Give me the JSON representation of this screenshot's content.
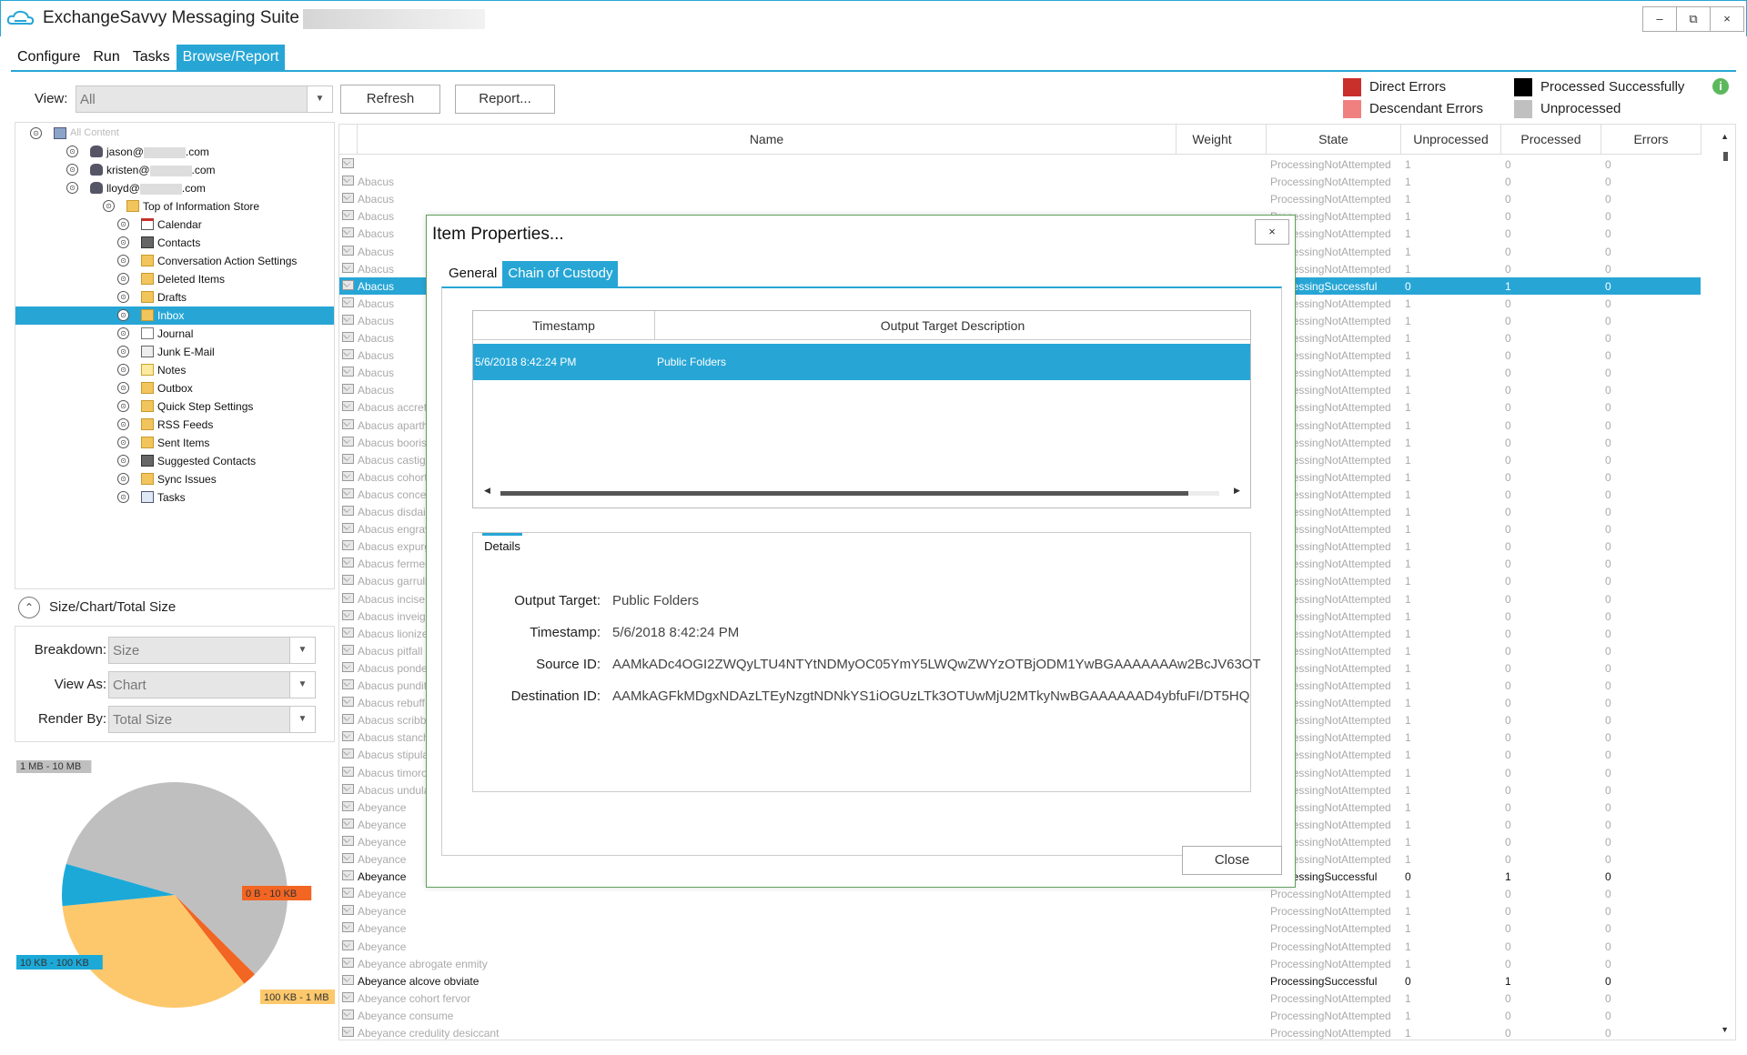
{
  "app": {
    "title": "ExchangeSavvy Messaging Suite -",
    "window_controls": {
      "minimize": "–",
      "restore": "⧉",
      "close": "×"
    }
  },
  "menu": [
    {
      "label": "Configure"
    },
    {
      "label": "Run"
    },
    {
      "label": "Tasks"
    },
    {
      "label": "Browse/Report",
      "active": true
    }
  ],
  "toolbar": {
    "view_label": "View:",
    "view_value": "All",
    "refresh_label": "Refresh",
    "report_label": "Report..."
  },
  "legend": [
    {
      "label": "Direct Errors",
      "color": "#c9302c"
    },
    {
      "label": "Descendant Errors",
      "color": "#f08080"
    },
    {
      "label": "Processed Successfully",
      "color": "#000000"
    },
    {
      "label": "Unprocessed",
      "color": "#c0c0c0"
    }
  ],
  "tree": {
    "root": "All Content",
    "users": [
      {
        "prefix": "jason@",
        "suffix": ".com"
      },
      {
        "prefix": "kristen@",
        "suffix": ".com"
      },
      {
        "prefix": "lloyd@",
        "suffix": ".com"
      }
    ],
    "store": "Top of Information Store",
    "folders": [
      {
        "label": "Calendar",
        "icon": "calendar-icon"
      },
      {
        "label": "Contacts",
        "icon": "contacts-icon"
      },
      {
        "label": "Conversation Action Settings",
        "icon": "folder-icon"
      },
      {
        "label": "Deleted Items",
        "icon": "folder-icon"
      },
      {
        "label": "Drafts",
        "icon": "folder-icon"
      },
      {
        "label": "Inbox",
        "icon": "folder-icon",
        "selected": true
      },
      {
        "label": "Journal",
        "icon": "journal-icon"
      },
      {
        "label": "Junk E-Mail",
        "icon": "junk-icon"
      },
      {
        "label": "Notes",
        "icon": "notes-icon"
      },
      {
        "label": "Outbox",
        "icon": "folder-icon"
      },
      {
        "label": "Quick Step Settings",
        "icon": "folder-icon"
      },
      {
        "label": "RSS Feeds",
        "icon": "folder-icon"
      },
      {
        "label": "Sent Items",
        "icon": "folder-icon"
      },
      {
        "label": "Suggested Contacts",
        "icon": "contacts-icon"
      },
      {
        "label": "Sync Issues",
        "icon": "folder-icon"
      },
      {
        "label": "Tasks",
        "icon": "tasks-icon"
      }
    ]
  },
  "size_panel": {
    "header": "Size/Chart/Total Size",
    "breakdown_label": "Breakdown:",
    "breakdown_value": "Size",
    "view_as_label": "View As:",
    "view_as_value": "Chart",
    "render_by_label": "Render By:",
    "render_by_value": "Total Size"
  },
  "chart_data": {
    "type": "pie",
    "slices": [
      {
        "label": "1 MB - 10 MB",
        "value": 0.58,
        "color": "#c0bfc0"
      },
      {
        "label": "0 B - 10 KB",
        "value": 0.02,
        "color": "#f26522"
      },
      {
        "label": "100 KB - 1 MB",
        "value": 0.34,
        "color": "#fdc86c"
      },
      {
        "label": "10 KB - 100 KB",
        "value": 0.06,
        "color": "#1ca9d8"
      }
    ]
  },
  "grid": {
    "columns": [
      "Name",
      "Weight",
      "State",
      "Unprocessed",
      "Processed",
      "Errors"
    ],
    "rows": [
      {
        "name": "",
        "state": "ProcessingNotAttempted",
        "u": "1",
        "p": "0",
        "e": "0"
      },
      {
        "name": "Abacus",
        "state": "ProcessingNotAttempted",
        "u": "1",
        "p": "0",
        "e": "0"
      },
      {
        "name": "Abacus",
        "state": "ProcessingNotAttempted",
        "u": "1",
        "p": "0",
        "e": "0"
      },
      {
        "name": "Abacus",
        "state": "ProcessingNotAttempted",
        "u": "1",
        "p": "0",
        "e": "0"
      },
      {
        "name": "Abacus",
        "state": "ProcessingNotAttempted",
        "u": "1",
        "p": "0",
        "e": "0"
      },
      {
        "name": "Abacus",
        "state": "ProcessingNotAttempted",
        "u": "1",
        "p": "0",
        "e": "0"
      },
      {
        "name": "Abacus",
        "state": "ProcessingNotAttempted",
        "u": "1",
        "p": "0",
        "e": "0"
      },
      {
        "name": "Abacus",
        "state": "ProcessingSuccessful",
        "u": "0",
        "p": "1",
        "e": "0",
        "selected": true
      },
      {
        "name": "Abacus",
        "state": "ProcessingNotAttempted",
        "u": "1",
        "p": "0",
        "e": "0"
      },
      {
        "name": "Abacus",
        "state": "ProcessingNotAttempted",
        "u": "1",
        "p": "0",
        "e": "0"
      },
      {
        "name": "Abacus",
        "state": "ProcessingNotAttempted",
        "u": "1",
        "p": "0",
        "e": "0"
      },
      {
        "name": "Abacus",
        "state": "ProcessingNotAttempted",
        "u": "1",
        "p": "0",
        "e": "0"
      },
      {
        "name": "Abacus",
        "state": "ProcessingNotAttempted",
        "u": "1",
        "p": "0",
        "e": "0"
      },
      {
        "name": "Abacus",
        "state": "ProcessingNotAttempted",
        "u": "1",
        "p": "0",
        "e": "0"
      },
      {
        "name": "Abacus accret",
        "state": "ProcessingNotAttempted",
        "u": "1",
        "p": "0",
        "e": "0"
      },
      {
        "name": "Abacus aparth",
        "state": "ProcessingNotAttempted",
        "u": "1",
        "p": "0",
        "e": "0"
      },
      {
        "name": "Abacus booris",
        "state": "ProcessingNotAttempted",
        "u": "1",
        "p": "0",
        "e": "0"
      },
      {
        "name": "Abacus castiga",
        "state": "ProcessingNotAttempted",
        "u": "1",
        "p": "0",
        "e": "0"
      },
      {
        "name": "Abacus cohort",
        "state": "ProcessingNotAttempted",
        "u": "1",
        "p": "0",
        "e": "0"
      },
      {
        "name": "Abacus conce",
        "state": "ProcessingNotAttempted",
        "u": "1",
        "p": "0",
        "e": "0"
      },
      {
        "name": "Abacus disdai",
        "state": "ProcessingNotAttempted",
        "u": "1",
        "p": "0",
        "e": "0"
      },
      {
        "name": "Abacus engrav",
        "state": "ProcessingNotAttempted",
        "u": "1",
        "p": "0",
        "e": "0"
      },
      {
        "name": "Abacus expurg",
        "state": "ProcessingNotAttempted",
        "u": "1",
        "p": "0",
        "e": "0"
      },
      {
        "name": "Abacus fermen",
        "state": "ProcessingNotAttempted",
        "u": "1",
        "p": "0",
        "e": "0"
      },
      {
        "name": "Abacus garruli",
        "state": "ProcessingNotAttempted",
        "u": "1",
        "p": "0",
        "e": "0"
      },
      {
        "name": "Abacus incise",
        "state": "ProcessingNotAttempted",
        "u": "1",
        "p": "0",
        "e": "0"
      },
      {
        "name": "Abacus inveigl",
        "state": "ProcessingNotAttempted",
        "u": "1",
        "p": "0",
        "e": "0"
      },
      {
        "name": "Abacus lionize",
        "state": "ProcessingNotAttempted",
        "u": "1",
        "p": "0",
        "e": "0"
      },
      {
        "name": "Abacus pitfall",
        "state": "ProcessingNotAttempted",
        "u": "1",
        "p": "0",
        "e": "0"
      },
      {
        "name": "Abacus ponde",
        "state": "ProcessingNotAttempted",
        "u": "1",
        "p": "0",
        "e": "0"
      },
      {
        "name": "Abacus pundit",
        "state": "ProcessingNotAttempted",
        "u": "1",
        "p": "0",
        "e": "0"
      },
      {
        "name": "Abacus rebuff",
        "state": "ProcessingNotAttempted",
        "u": "1",
        "p": "0",
        "e": "0"
      },
      {
        "name": "Abacus scribbl",
        "state": "ProcessingNotAttempted",
        "u": "1",
        "p": "0",
        "e": "0"
      },
      {
        "name": "Abacus stanch",
        "state": "ProcessingNotAttempted",
        "u": "1",
        "p": "0",
        "e": "0"
      },
      {
        "name": "Abacus stipula",
        "state": "ProcessingNotAttempted",
        "u": "1",
        "p": "0",
        "e": "0"
      },
      {
        "name": "Abacus timoro",
        "state": "ProcessingNotAttempted",
        "u": "1",
        "p": "0",
        "e": "0"
      },
      {
        "name": "Abacus undula",
        "state": "ProcessingNotAttempted",
        "u": "1",
        "p": "0",
        "e": "0"
      },
      {
        "name": "Abeyance",
        "state": "ProcessingNotAttempted",
        "u": "1",
        "p": "0",
        "e": "0"
      },
      {
        "name": "Abeyance",
        "state": "ProcessingNotAttempted",
        "u": "1",
        "p": "0",
        "e": "0"
      },
      {
        "name": "Abeyance",
        "state": "ProcessingNotAttempted",
        "u": "1",
        "p": "0",
        "e": "0"
      },
      {
        "name": "Abeyance",
        "state": "ProcessingNotAttempted",
        "u": "1",
        "p": "0",
        "e": "0"
      },
      {
        "name": "Abeyance",
        "state": "ProcessingSuccessful",
        "u": "0",
        "p": "1",
        "e": "0",
        "dark": true
      },
      {
        "name": "Abeyance",
        "state": "ProcessingNotAttempted",
        "u": "1",
        "p": "0",
        "e": "0"
      },
      {
        "name": "Abeyance",
        "state": "ProcessingNotAttempted",
        "u": "1",
        "p": "0",
        "e": "0"
      },
      {
        "name": "Abeyance",
        "state": "ProcessingNotAttempted",
        "u": "1",
        "p": "0",
        "e": "0"
      },
      {
        "name": "Abeyance",
        "state": "ProcessingNotAttempted",
        "u": "1",
        "p": "0",
        "e": "0"
      },
      {
        "name": "Abeyance abrogate enmity",
        "state": "ProcessingNotAttempted",
        "u": "1",
        "p": "0",
        "e": "0"
      },
      {
        "name": "Abeyance alcove obviate",
        "state": "ProcessingSuccessful",
        "u": "0",
        "p": "1",
        "e": "0",
        "dark": true
      },
      {
        "name": "Abeyance cohort fervor",
        "state": "ProcessingNotAttempted",
        "u": "1",
        "p": "0",
        "e": "0"
      },
      {
        "name": "Abeyance consume",
        "state": "ProcessingNotAttempted",
        "u": "1",
        "p": "0",
        "e": "0"
      },
      {
        "name": "Abeyance credulity desiccant",
        "state": "ProcessingNotAttempted",
        "u": "1",
        "p": "0",
        "e": "0"
      }
    ]
  },
  "dialog": {
    "title": "Item Properties...",
    "close_x": "×",
    "tabs": [
      {
        "label": "General"
      },
      {
        "label": "Chain of Custody",
        "active": true
      }
    ],
    "coc_columns": [
      "Timestamp",
      "Output Target Description"
    ],
    "coc_rows": [
      {
        "timestamp": "5/6/2018 8:42:24 PM",
        "description": "Public Folders"
      }
    ],
    "details_tab": "Details",
    "details": {
      "output_target_label": "Output Target:",
      "output_target": "Public Folders",
      "timestamp_label": "Timestamp:",
      "timestamp": "5/6/2018 8:42:24 PM",
      "source_id_label": "Source ID:",
      "source_id": "AAMkADc4OGI2ZWQyLTU4NTYtNDMyOC05YmY5LWQwZWYzOTBjODM1YwBGAAAAAAAw2BcJV63OT",
      "destination_id_label": "Destination ID:",
      "destination_id": "AAMkAGFkMDgxNDAzLTEyNzgtNDNkYS1iOGUzLTk3OTUwMjU2MTkyNwBGAAAAAAD4ybfuFI/DT5HQ"
    },
    "close_button": "Close"
  }
}
